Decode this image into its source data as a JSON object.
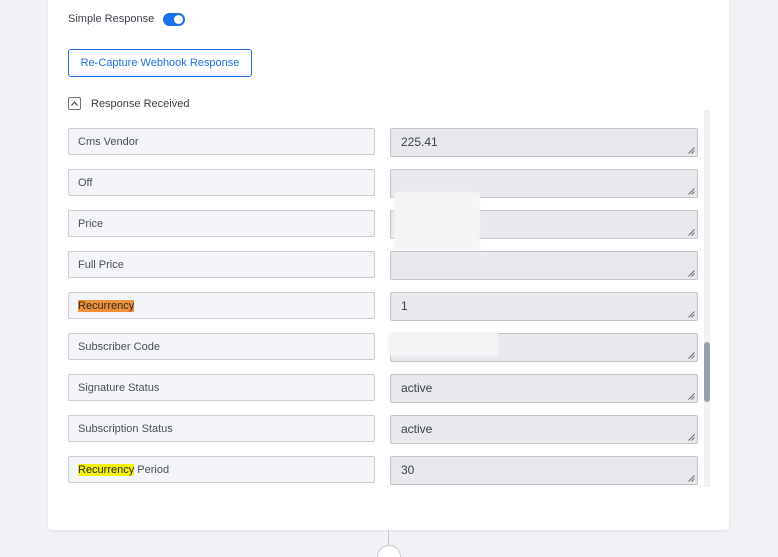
{
  "simple_response": {
    "label": "Simple Response",
    "enabled": true
  },
  "recapture_button": {
    "label": "Re-Capture Webhook Response"
  },
  "response_received": {
    "label": "Response Received",
    "expanded": true
  },
  "rows": [
    {
      "key_parts": [
        {
          "text": "Cms Vendor"
        }
      ],
      "value": "225.41"
    },
    {
      "key_parts": [
        {
          "text": "Off"
        }
      ],
      "value": ""
    },
    {
      "key_parts": [
        {
          "text": "Price"
        }
      ],
      "value": ""
    },
    {
      "key_parts": [
        {
          "text": "Full Price"
        }
      ],
      "value": ""
    },
    {
      "key_parts": [
        {
          "text": "Recurrency",
          "highlight": "orange"
        }
      ],
      "value": "1"
    },
    {
      "key_parts": [
        {
          "text": "Subscriber Code"
        }
      ],
      "value": ""
    },
    {
      "key_parts": [
        {
          "text": "Signature Status"
        }
      ],
      "value": "active"
    },
    {
      "key_parts": [
        {
          "text": "Subscription Status"
        }
      ],
      "value": "active"
    },
    {
      "key_parts": [
        {
          "text": "Recurrency",
          "highlight": "yellow"
        },
        {
          "text": " Period"
        }
      ],
      "value": "30"
    }
  ],
  "colors": {
    "accent": "#1f6fe0",
    "highlight_orange": "#f0913a",
    "highlight_yellow": "#f4f00f"
  },
  "icons": {
    "toggle": "toggle-switch-icon",
    "collapse": "chevron-up-icon",
    "resize": "resize-grip-icon",
    "add": "plus-icon"
  }
}
